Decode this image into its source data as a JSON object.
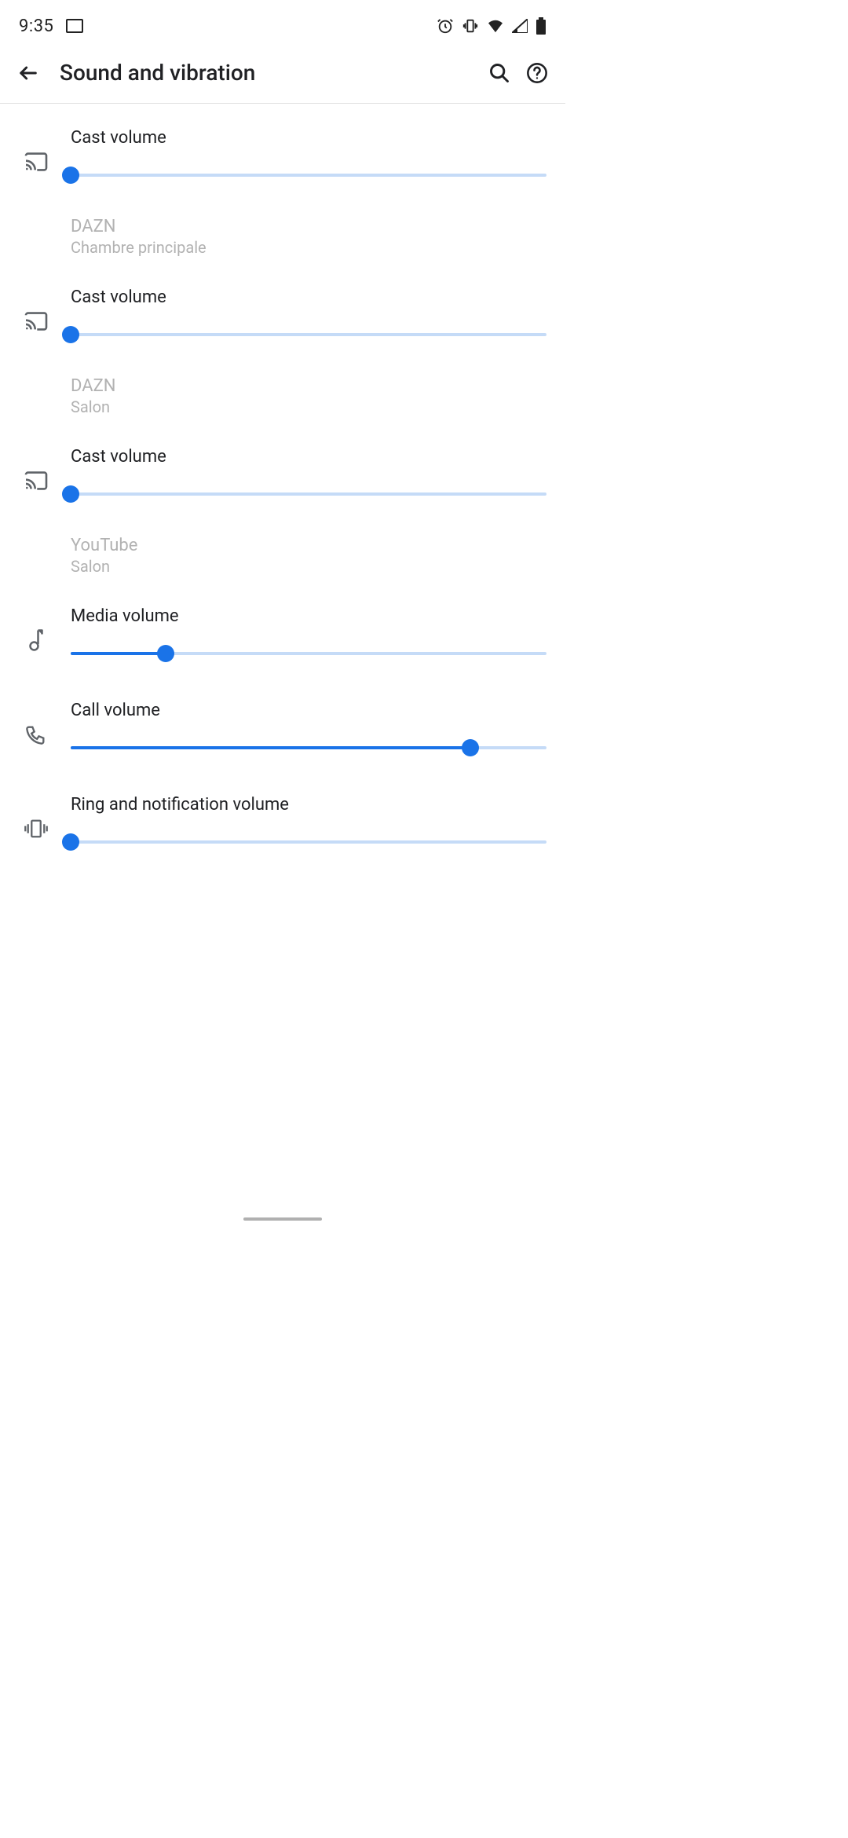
{
  "status": {
    "time": "9:35"
  },
  "header": {
    "title": "Sound and vibration"
  },
  "sliders": [
    {
      "title": "Cast volume",
      "value": 0,
      "icon": "cast"
    },
    {
      "title": "Cast volume",
      "value": 0,
      "icon": "cast"
    },
    {
      "title": "Cast volume",
      "value": 0,
      "icon": "cast"
    },
    {
      "title": "Media volume",
      "value": 20,
      "icon": "music"
    },
    {
      "title": "Call volume",
      "value": 84,
      "icon": "phone"
    },
    {
      "title": "Ring and notification volume",
      "value": 0,
      "icon": "vibrate"
    }
  ],
  "infos": [
    {
      "primary": "DAZN",
      "secondary": "Chambre principale"
    },
    {
      "primary": "DAZN",
      "secondary": "Salon"
    },
    {
      "primary": "YouTube",
      "secondary": "Salon"
    }
  ]
}
